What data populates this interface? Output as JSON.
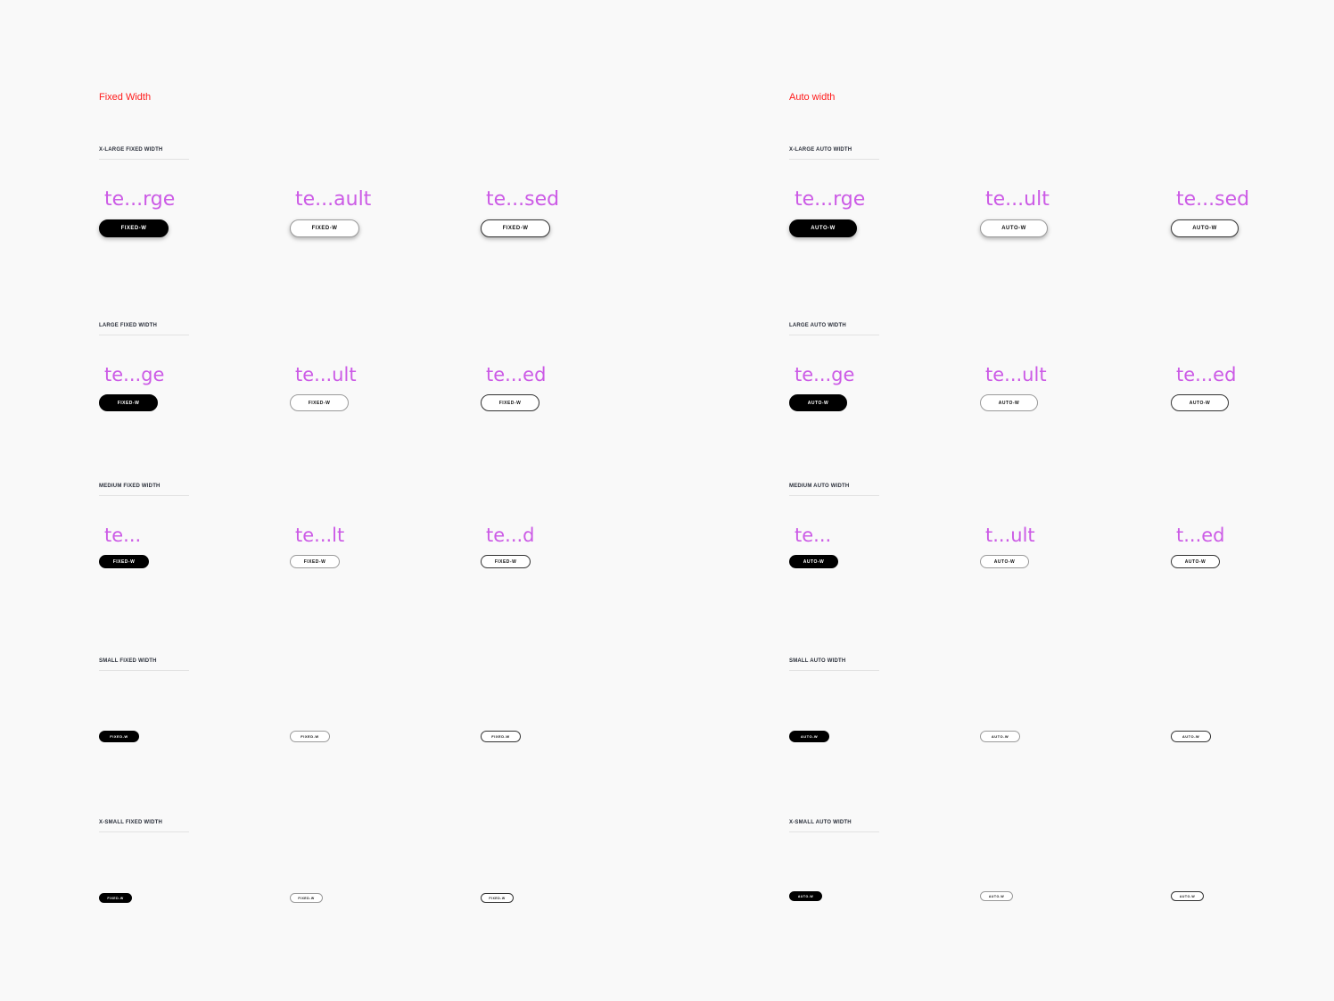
{
  "groups": [
    {
      "title": "Fixed Width",
      "sections": [
        {
          "heading": "X-LARGE FIXED WIDTH",
          "labels": [
            "te...rge",
            "te...ault",
            "te...sed"
          ],
          "button": "FIXED-W"
        },
        {
          "heading": "LARGE FIXED WIDTH",
          "labels": [
            "te...ge",
            "te...ult",
            "te...ed"
          ],
          "button": "FIXED-W"
        },
        {
          "heading": "MEDIUM FIXED WIDTH",
          "labels": [
            "te...",
            "te...lt",
            "te...d"
          ],
          "button": "FIXED-W"
        },
        {
          "heading": "SMALL FIXED WIDTH",
          "labels": [],
          "button": "FIXED-W"
        },
        {
          "heading": "X-SMALL FIXED WIDTH",
          "labels": [],
          "button": "FIXED-W"
        }
      ]
    },
    {
      "title": "Auto width",
      "sections": [
        {
          "heading": "X-LARGE AUTO WIDTH",
          "labels": [
            "te...rge",
            "te...ult",
            "te...sed"
          ],
          "button": "AUTO-W"
        },
        {
          "heading": "LARGE AUTO WIDTH",
          "labels": [
            "te...ge",
            "te...ult",
            "te...ed"
          ],
          "button": "AUTO-W"
        },
        {
          "heading": "MEDIUM AUTO WIDTH",
          "labels": [
            "te...",
            "t...ult",
            "t...ed"
          ],
          "button": "AUTO-W"
        },
        {
          "heading": "SMALL AUTO WIDTH",
          "labels": [],
          "button": "AUTO-W"
        },
        {
          "heading": "X-SMALL AUTO WIDTH",
          "labels": [],
          "button": "AUTO-W"
        }
      ]
    }
  ],
  "variants": [
    "primary",
    "secondary",
    "outlined"
  ],
  "colors": {
    "accent_title": "#ff1a1a",
    "label": "#cc5be6",
    "primary_bg": "#000000"
  }
}
